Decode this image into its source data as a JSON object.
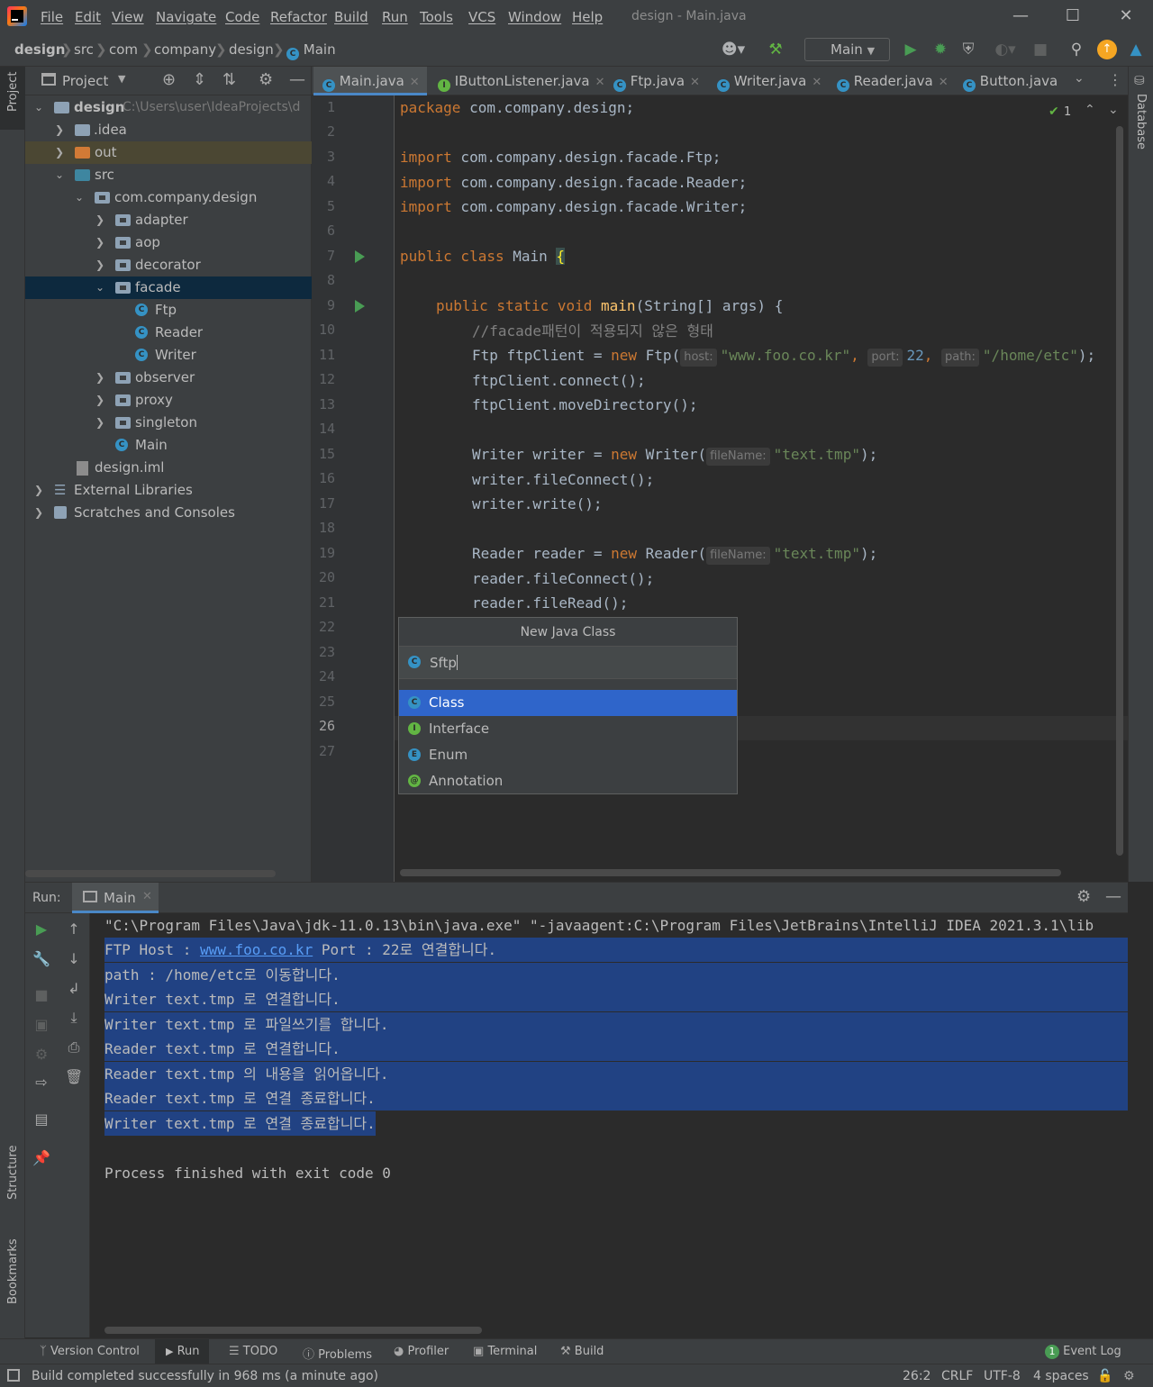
{
  "window": {
    "title": "design - Main.java"
  },
  "menu": [
    "File",
    "Edit",
    "View",
    "Navigate",
    "Code",
    "Refactor",
    "Build",
    "Run",
    "Tools",
    "VCS",
    "Window",
    "Help"
  ],
  "breadcrumb": [
    "design",
    "src",
    "com",
    "company",
    "design",
    "Main"
  ],
  "toolbar": {
    "run_config": "Main"
  },
  "sidebar_left": {
    "project": "Project",
    "structure": "Structure",
    "bookmarks": "Bookmarks"
  },
  "sidebar_right": {
    "database": "Database"
  },
  "project_panel": {
    "title": "Project",
    "root_label": "design",
    "root_path": "C:\\Users\\user\\IdeaProjects\\d",
    "items": [
      {
        "label": ".idea"
      },
      {
        "label": "out"
      },
      {
        "label": "src"
      },
      {
        "label": "com.company.design"
      },
      {
        "label": "adapter"
      },
      {
        "label": "aop"
      },
      {
        "label": "decorator"
      },
      {
        "label": "facade"
      },
      {
        "label": "Ftp"
      },
      {
        "label": "Reader"
      },
      {
        "label": "Writer"
      },
      {
        "label": "observer"
      },
      {
        "label": "proxy"
      },
      {
        "label": "singleton"
      },
      {
        "label": "Main"
      },
      {
        "label": "design.iml"
      },
      {
        "label": "External Libraries"
      },
      {
        "label": "Scratches and Consoles"
      }
    ]
  },
  "editor_tabs": [
    "Main.java",
    "IButtonListener.java",
    "Ftp.java",
    "Writer.java",
    "Reader.java",
    "Button.java"
  ],
  "inspection": {
    "count": "1"
  },
  "code": {
    "line_numbers": [
      "1",
      "2",
      "3",
      "4",
      "5",
      "6",
      "7",
      "8",
      "9",
      "10",
      "11",
      "12",
      "13",
      "14",
      "15",
      "16",
      "17",
      "18",
      "19",
      "20",
      "21",
      "22",
      "23",
      "24",
      "25",
      "26",
      "27"
    ],
    "kw_package": "package",
    "l1": " com.company.design;",
    "kw_import": "import",
    "l3": " com.company.design.facade.Ftp;",
    "l4": " com.company.design.facade.Reader;",
    "l5": " com.company.design.facade.Writer;",
    "kw_public_class": "public class",
    "l7": " Main ",
    "brace_open": "{",
    "kw_public_static_void": "public static void",
    "fn_main": " main",
    "l9_rest": "(String[] args) {",
    "l10": "//facade패턴이 적용되지 않은 형태",
    "l11a": "Ftp ftpClient = ",
    "kw_new": "new",
    "l11b": " Ftp(",
    "hint_host": "host:",
    "str_host": "\"www.foo.co.kr\"",
    "comma": ", ",
    "hint_port": "port:",
    "num_port": "22",
    "hint_path": "path:",
    "str_path": "\"/home/etc\"",
    "l11c": ");",
    "l12": "ftpClient.connect();",
    "l13": "ftpClient.moveDirectory();",
    "l15a": "Writer writer = ",
    "l15b": " Writer(",
    "hint_filename": "fileName:",
    "str_file": "\"text.tmp\"",
    "l15c": ");",
    "l16": "writer.fileConnect();",
    "l17": "writer.write();",
    "l19a": "Reader reader = ",
    "l19b": " Reader(",
    "l20": "reader.fileConnect();",
    "l21": "reader.fileRead();"
  },
  "popup": {
    "title": "New Java Class",
    "input_value": "Sftp",
    "options": [
      "Class",
      "Interface",
      "Enum",
      "Annotation"
    ]
  },
  "run_panel": {
    "label": "Run:",
    "tab": "Main",
    "output": [
      "\"C:\\Program Files\\Java\\jdk-11.0.13\\bin\\java.exe\" \"-javaagent:C:\\Program Files\\JetBrains\\IntelliJ IDEA 2021.3.1\\lib",
      "FTP Host : ",
      "www.foo.co.kr",
      " Port : 22로 연결합니다.",
      "path : /home/etc로 이동합니다.",
      "Writer text.tmp 로 연결합니다.",
      "Writer text.tmp 로 파일쓰기를 합니다.",
      "Reader text.tmp 로 연결합니다.",
      "Reader text.tmp 의 내용을 읽어옵니다.",
      "Reader text.tmp 로 연결 종료합니다.",
      "Writer text.tmp 로 연결 종료합니다.",
      "Process finished with exit code 0"
    ]
  },
  "bottom_tabs": [
    "Version Control",
    "Run",
    "TODO",
    "Problems",
    "Profiler",
    "Terminal",
    "Build"
  ],
  "event_log": {
    "count": "1",
    "label": "Event Log"
  },
  "status": {
    "message": "Build completed successfully in 968 ms (a minute ago)",
    "position": "26:2",
    "line_sep": "CRLF",
    "encoding": "UTF-8",
    "indent": "4 spaces"
  },
  "colors": {
    "accent": "#2f65ca",
    "run_green": "#499c54",
    "keyword": "#cc7832",
    "string": "#6a8759",
    "selection": "#214283"
  }
}
